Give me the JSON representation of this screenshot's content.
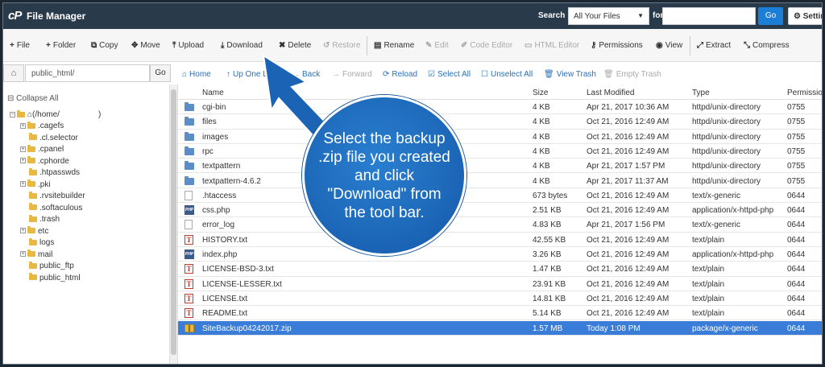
{
  "header": {
    "logo": "cP",
    "title": "File Manager",
    "search_label": "Search",
    "search_scope": "All Your Files",
    "for_label": "for",
    "search_placeholder": "",
    "go_label": "Go",
    "settings_label": "Settings"
  },
  "toolbar": {
    "items": [
      {
        "label": "File",
        "icon": "+"
      },
      {
        "label": "Folder",
        "icon": "+"
      },
      {
        "label": "Copy",
        "icon": "⧉"
      },
      {
        "label": "Move",
        "icon": "✥"
      },
      {
        "label": "Upload",
        "icon": "⤒"
      },
      {
        "label": "Download",
        "icon": "⤓"
      },
      {
        "label": "Delete",
        "icon": "✖"
      },
      {
        "label": "Restore",
        "icon": "↺"
      },
      {
        "label": "Rename",
        "icon": "▤"
      },
      {
        "label": "Edit",
        "icon": "✎"
      },
      {
        "label": "Code Editor",
        "icon": "✐"
      },
      {
        "label": "HTML Editor",
        "icon": "▭"
      },
      {
        "label": "Permissions",
        "icon": "⚷"
      },
      {
        "label": "View",
        "icon": "◉"
      },
      {
        "label": "Extract",
        "icon": "⤢"
      },
      {
        "label": "Compress",
        "icon": "⤡"
      }
    ]
  },
  "nav": {
    "path_value": "public_html/",
    "go_label": "Go",
    "home": "Home",
    "up_one": "Up One Level",
    "back": "Back",
    "forward": "Forward",
    "reload": "Reload",
    "select_all": "Select All",
    "unselect_all": "Unselect All",
    "view_trash": "View Trash",
    "empty_trash": "Empty Trash"
  },
  "tree": {
    "collapse_all": "Collapse All",
    "root": "(/home/",
    "root_suffix": ")",
    "items": [
      ".cagefs",
      ".cl.selector",
      ".cpanel",
      ".cphorde",
      ".htpasswds",
      ".pki",
      ".rvsitebuilder",
      ".softaculous",
      ".trash",
      "etc",
      "logs",
      "mail",
      "public_ftp",
      "public_html"
    ]
  },
  "table": {
    "headers": [
      "Name",
      "Size",
      "Last Modified",
      "Type",
      "Permissions"
    ],
    "rows": [
      {
        "icon": "folder",
        "name": "cgi-bin",
        "size": "4 KB",
        "modified": "Apr 21, 2017 10:36 AM",
        "type": "httpd/unix-directory",
        "perms": "0755"
      },
      {
        "icon": "folder",
        "name": "files",
        "size": "4 KB",
        "modified": "Oct 21, 2016 12:49 AM",
        "type": "httpd/unix-directory",
        "perms": "0755"
      },
      {
        "icon": "folder",
        "name": "images",
        "size": "4 KB",
        "modified": "Oct 21, 2016 12:49 AM",
        "type": "httpd/unix-directory",
        "perms": "0755"
      },
      {
        "icon": "folder",
        "name": "rpc",
        "size": "4 KB",
        "modified": "Oct 21, 2016 12:49 AM",
        "type": "httpd/unix-directory",
        "perms": "0755"
      },
      {
        "icon": "folder",
        "name": "textpattern",
        "size": "4 KB",
        "modified": "Apr 21, 2017 1:57 PM",
        "type": "httpd/unix-directory",
        "perms": "0755"
      },
      {
        "icon": "folder",
        "name": "textpattern-4.6.2",
        "size": "4 KB",
        "modified": "Apr 21, 2017 11:37 AM",
        "type": "httpd/unix-directory",
        "perms": "0755"
      },
      {
        "icon": "generic",
        "name": ".htaccess",
        "size": "673 bytes",
        "modified": "Oct 21, 2016 12:49 AM",
        "type": "text/x-generic",
        "perms": "0644"
      },
      {
        "icon": "php",
        "name": "css.php",
        "size": "2.51 KB",
        "modified": "Oct 21, 2016 12:49 AM",
        "type": "application/x-httpd-php",
        "perms": "0644"
      },
      {
        "icon": "generic",
        "name": "error_log",
        "size": "4.83 KB",
        "modified": "Apr 21, 2017 1:56 PM",
        "type": "text/x-generic",
        "perms": "0644"
      },
      {
        "icon": "text",
        "name": "HISTORY.txt",
        "size": "42.55 KB",
        "modified": "Oct 21, 2016 12:49 AM",
        "type": "text/plain",
        "perms": "0644"
      },
      {
        "icon": "php",
        "name": "index.php",
        "size": "3.26 KB",
        "modified": "Oct 21, 2016 12:49 AM",
        "type": "application/x-httpd-php",
        "perms": "0644"
      },
      {
        "icon": "text",
        "name": "LICENSE-BSD-3.txt",
        "size": "1.47 KB",
        "modified": "Oct 21, 2016 12:49 AM",
        "type": "text/plain",
        "perms": "0644"
      },
      {
        "icon": "text",
        "name": "LICENSE-LESSER.txt",
        "size": "23.91 KB",
        "modified": "Oct 21, 2016 12:49 AM",
        "type": "text/plain",
        "perms": "0644"
      },
      {
        "icon": "text",
        "name": "LICENSE.txt",
        "size": "14.81 KB",
        "modified": "Oct 21, 2016 12:49 AM",
        "type": "text/plain",
        "perms": "0644"
      },
      {
        "icon": "text",
        "name": "README.txt",
        "size": "5.14 KB",
        "modified": "Oct 21, 2016 12:49 AM",
        "type": "text/plain",
        "perms": "0644"
      },
      {
        "icon": "zip",
        "name": "SiteBackup04242017.zip",
        "size": "1.57 MB",
        "modified": "Today 1:08 PM",
        "type": "package/x-generic",
        "perms": "0644",
        "selected": true
      }
    ]
  },
  "callout": {
    "text": "Select the backup .zip file you created and click \"Download\" from the tool bar."
  },
  "colors": {
    "header_bg": "#293a4a",
    "accent": "#1d7ed8",
    "selected_row": "#3a7dd8",
    "callout_blue": "#1b64b5"
  }
}
